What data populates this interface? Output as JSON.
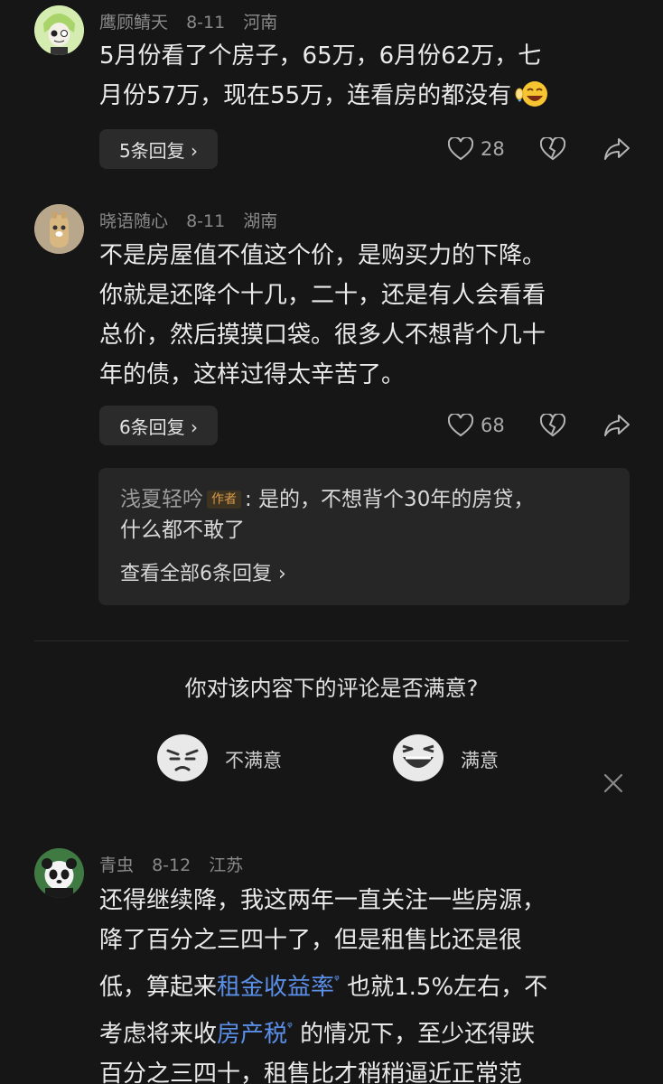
{
  "comments": [
    {
      "user": "鹰顾鲭天",
      "date": "8-11",
      "location": "河南",
      "text_lines": [
        "5月份看了个房子，65万，6月份62万，七",
        "月份57万，现在55万，连看房的都没有"
      ],
      "emoji": "laughing-crying-emoji",
      "replies_label": "5条回复 ›",
      "likes": "28"
    },
    {
      "user": "晓语随心",
      "date": "8-11",
      "location": "湖南",
      "text_lines": [
        "不是房屋值不值这个价，是购买力的下降。",
        "你就是还降个十几，二十，还是有人会看看",
        "总价，然后摸摸口袋。很多人不想背个几十",
        "年的债，这样过得太辛苦了。"
      ],
      "replies_label": "6条回复 ›",
      "likes": "68",
      "top_reply": {
        "user": "浅夏轻吟",
        "tag": "作者",
        "text_1": ": 是的，不想背个30年的房贷，",
        "text_2": "什么都不敢了",
        "view_all": "查看全部6条回复 ›"
      }
    },
    {
      "user": "青虫",
      "date": "8-12",
      "location": "江苏",
      "line1": "还得继续降，我这两年一直关注一些房源，",
      "line2": "降了百分之三四十了，但是租售比还是很",
      "line3_a": "低，算起来",
      "line3_kw": "租金收益率",
      "line3_b": " 也就1.5%左右，不",
      "line4_a": "考虑将来收",
      "line4_kw": "房产税",
      "line4_b": " 的情况下，至少还得跌",
      "line5": "百分之三四十，租售比才稍稍逼近正常范"
    }
  ],
  "survey": {
    "question": "你对该内容下的评论是否满意?",
    "dissatisfied": "不满意",
    "satisfied": "满意"
  },
  "colors": {
    "background": "#161616",
    "keyword_link": "#5b8fe8",
    "author_tag": "#d59a4c"
  }
}
